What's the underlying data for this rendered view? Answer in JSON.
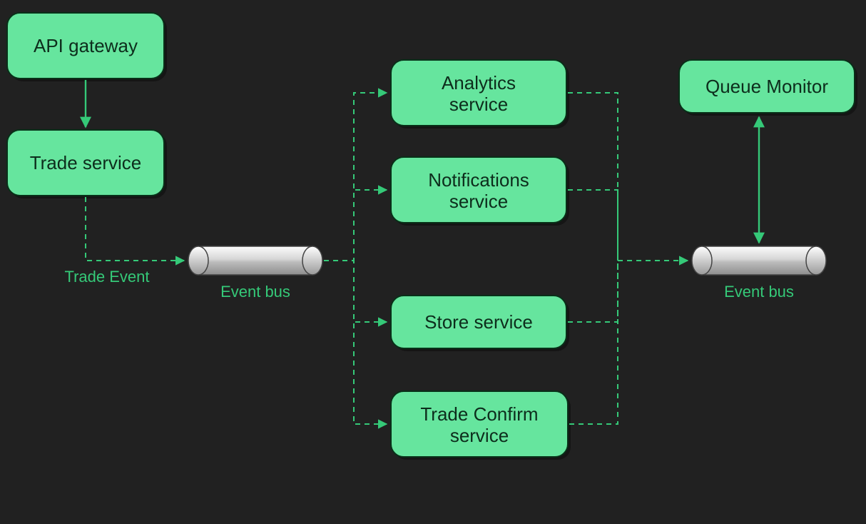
{
  "nodes": {
    "api_gateway": {
      "label": "API gateway"
    },
    "trade_service": {
      "label": "Trade service"
    },
    "analytics": {
      "label1": "Analytics",
      "label2": "service"
    },
    "notifications": {
      "label1": "Notifications",
      "label2": "service"
    },
    "store": {
      "label": "Store service"
    },
    "trade_confirm": {
      "label1": "Trade Confirm",
      "label2": "service"
    },
    "queue_monitor": {
      "label": "Queue Monitor"
    }
  },
  "buses": {
    "bus1": {
      "label": "Event bus"
    },
    "bus2": {
      "label": "Event bus"
    }
  },
  "edges": {
    "trade_event": {
      "label": "Trade Event"
    }
  },
  "style": {
    "node_fill": "#66E59E",
    "edge_color": "#35c978",
    "bg": "#212121"
  }
}
